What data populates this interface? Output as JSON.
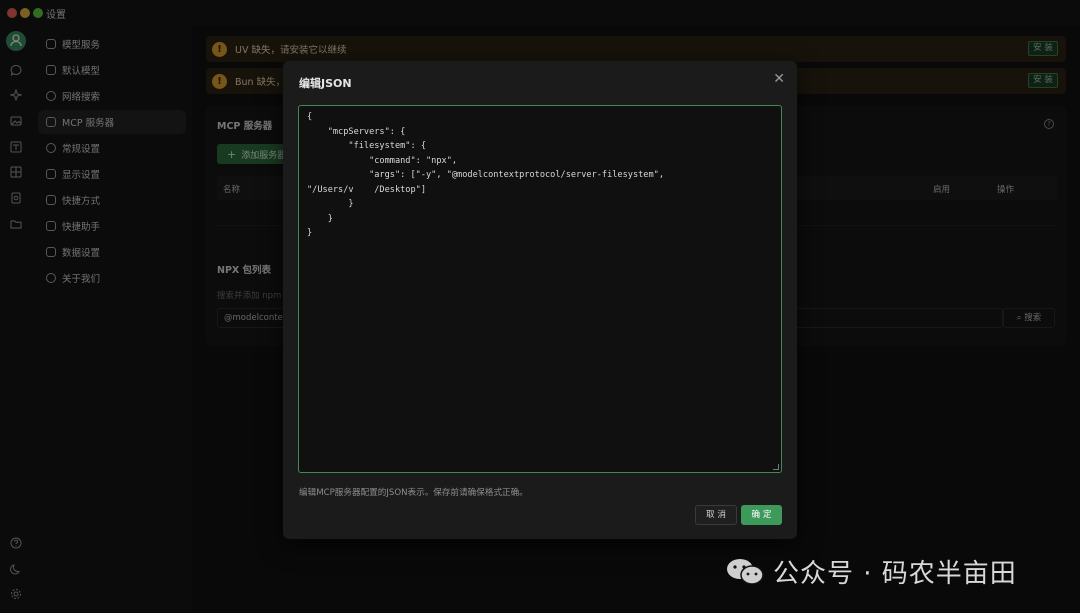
{
  "window": {
    "title": "设置"
  },
  "sidebar": {
    "items": [
      {
        "label": "模型服务",
        "icon": "cloud-icon"
      },
      {
        "label": "默认模型",
        "icon": "cube-icon"
      },
      {
        "label": "网络搜索",
        "icon": "globe-icon"
      },
      {
        "label": "MCP 服务器",
        "icon": "terminal-icon",
        "active": true
      },
      {
        "label": "常规设置",
        "icon": "gear-icon"
      },
      {
        "label": "显示设置",
        "icon": "display-icon"
      },
      {
        "label": "快捷方式",
        "icon": "shortcut-icon"
      },
      {
        "label": "快捷助手",
        "icon": "rocket-icon"
      },
      {
        "label": "数据设置",
        "icon": "database-icon"
      },
      {
        "label": "关于我们",
        "icon": "info-icon"
      }
    ]
  },
  "warnings": [
    {
      "text": "UV 缺失，请安装它以继续",
      "button": "安 装"
    },
    {
      "text": "Bun 缺失，请安装它以继续",
      "button": "安 装"
    }
  ],
  "mcp": {
    "title": "MCP 服务器",
    "add_button": "添加服务器",
    "columns": {
      "name": "名称",
      "enabled": "启用",
      "actions": "操作"
    }
  },
  "npx": {
    "title": "NPX 包列表",
    "hint": "搜索并添加 npm 包",
    "input_value": "@modelcontextprotocol/server-filesystem",
    "search_button": "搜索"
  },
  "modal": {
    "title": "编辑JSON",
    "json_text": "{\n    \"mcpServers\": {\n        \"filesystem\": {\n            \"command\": \"npx\",\n            \"args\": [\"-y\", \"@modelcontextprotocol/server-filesystem\",\n\"/Users/v    /Desktop\"]\n        }\n    }\n}",
    "hint": "编辑MCP服务器配置的JSON表示。保存前请确保格式正确。",
    "cancel": "取 消",
    "ok": "确 定"
  },
  "watermark": {
    "text": "公众号 · 码农半亩田"
  }
}
